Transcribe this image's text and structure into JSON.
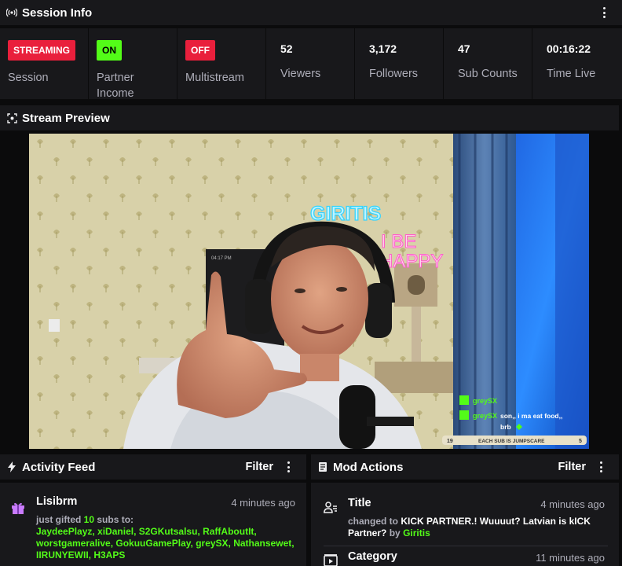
{
  "session": {
    "header_title": "Session Info",
    "stats": [
      {
        "kind": "badge",
        "badge": "STREAMING",
        "badge_color": "#e91f3c",
        "label": "Session"
      },
      {
        "kind": "badge",
        "badge": "ON",
        "badge_color": "#53fc18",
        "label": "Partner Income"
      },
      {
        "kind": "badge",
        "badge": "OFF",
        "badge_color": "#e91f3c",
        "label": "Multistream"
      },
      {
        "kind": "value",
        "value": "52",
        "label": "Viewers"
      },
      {
        "kind": "value",
        "value": "3,172",
        "label": "Followers"
      },
      {
        "kind": "value",
        "value": "47",
        "label": "Sub Counts"
      },
      {
        "kind": "value",
        "value": "00:16:22",
        "label": "Time Live"
      }
    ]
  },
  "preview": {
    "header_title": "Stream Preview",
    "neon_sign_1": "GIRITIS",
    "neon_sign_2_line1": "I BE",
    "neon_sign_2_line2": "HAPPY",
    "monitor_text": "04:17 PM",
    "chat": [
      {
        "user": "greySX",
        "text": ""
      },
      {
        "user": "greySX",
        "text": "son,, i ma eat food,, brb"
      }
    ],
    "goal_left": "19",
    "goal_text": "EACH SUB IS JUMPSCARE",
    "goal_right": "5"
  },
  "activity": {
    "header_title": "Activity Feed",
    "filter_label": "Filter",
    "item": {
      "user": "Lisibrm",
      "time": "4 minutes ago",
      "text_prefix": "just gifted",
      "count": "10",
      "text_suffix": "subs to:",
      "recipients": "JaydeePlayz, xiDaniel, S2GKutsalsu, RaffAboutIt, worstgameralive, GokuuGamePlay, greySX, Nathansewet, IIRUNYEWII, H3APS"
    }
  },
  "mod": {
    "header_title": "Mod Actions",
    "filter_label": "Filter",
    "items": [
      {
        "title": "Title",
        "time": "4 minutes ago",
        "prefix": "changed to",
        "new_title": "KICK PARTNER.! Wuuuut? Latvian is kICK Partner?",
        "by": "by",
        "user": "Giritis"
      },
      {
        "title": "Category",
        "time": "11 minutes ago"
      }
    ]
  },
  "colors": {
    "accent_green": "#53fc18",
    "red": "#e91f3c",
    "panel_bg": "#18181b",
    "page_bg": "#0b0b0c"
  },
  "icons": {
    "session": "broadcast-icon",
    "preview": "preview-icon",
    "activity": "bolt-icon",
    "mod": "document-icon",
    "gift": "gift-icon",
    "title_change": "user-edit-icon",
    "category": "category-icon"
  }
}
